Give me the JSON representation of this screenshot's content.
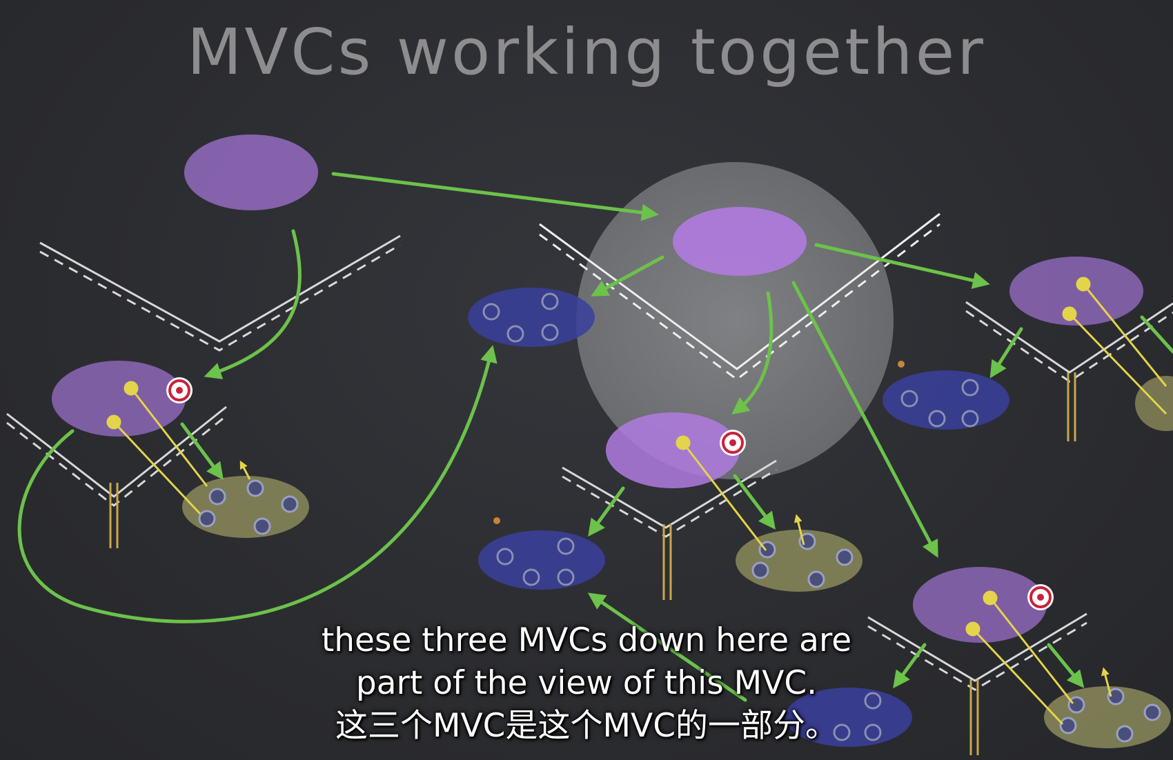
{
  "slide": {
    "title": "MVCs working together"
  },
  "subtitles": {
    "line1": "these three MVCs down here are",
    "line2": "part of the view of this MVC.",
    "line3": "这三个MVC是这个MVC的一部分。"
  },
  "colors": {
    "background": "#2b2c30",
    "controller": "#9b6fc9",
    "view": "#3a3f9e",
    "model": "#8b8a5a",
    "arrow": "#6cc24a",
    "target": "#c8223a",
    "action": "#e3d44a"
  },
  "icons": [
    "target-icon",
    "action-arrows-icon",
    "outlet-icon"
  ]
}
